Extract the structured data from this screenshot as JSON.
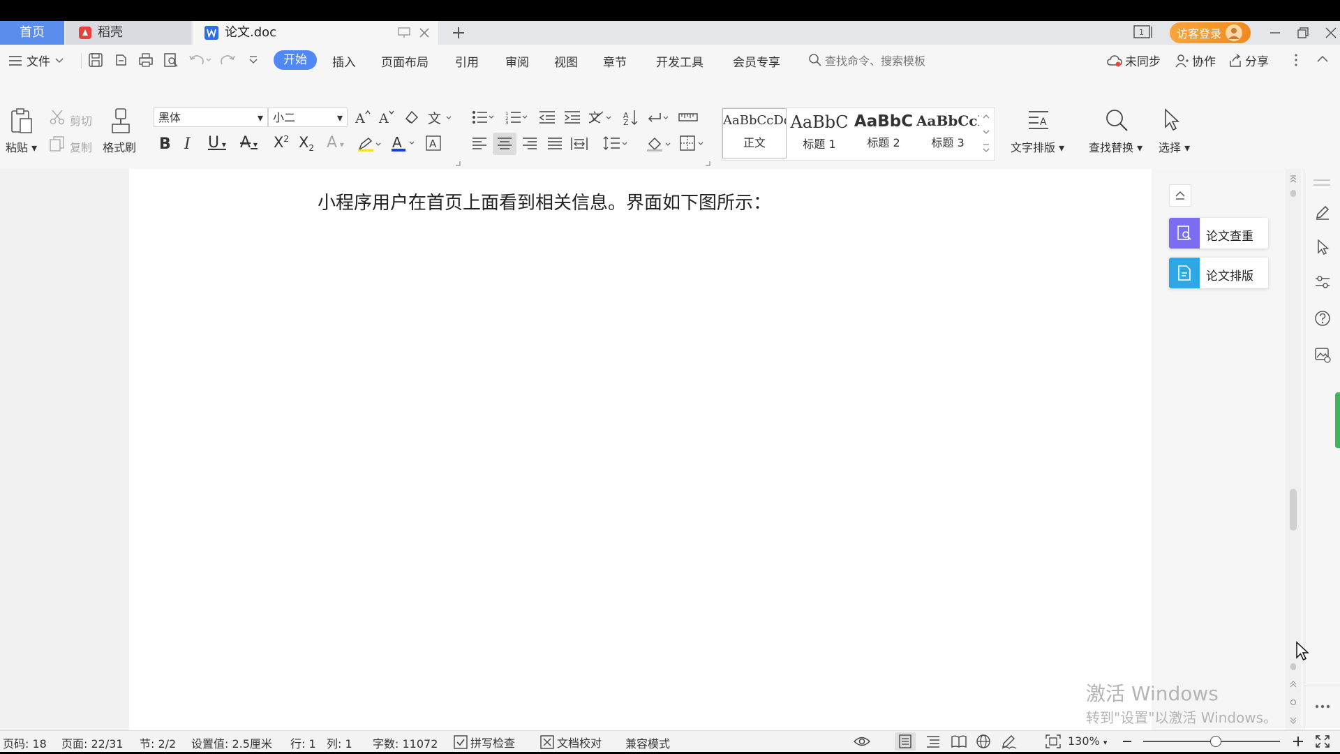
{
  "tabs": {
    "home": "首页",
    "daoke": "稻壳",
    "doc": "论文.doc"
  },
  "titlebar": {
    "login": "访客登录"
  },
  "menu": {
    "file": "文件",
    "items": [
      "开始",
      "插入",
      "页面布局",
      "引用",
      "审阅",
      "视图",
      "章节",
      "开发工具",
      "会员专享"
    ],
    "search_placeholder": "查找命令、搜索模板",
    "sync": "未同步",
    "collab": "协作",
    "share": "分享"
  },
  "ribbon": {
    "paste": "粘贴",
    "cut": "剪切",
    "copy": "复制",
    "format_painter": "格式刷",
    "font_name": "黑体",
    "font_size": "小二",
    "styles": [
      {
        "sample": "AaBbCcDd",
        "name": "正文"
      },
      {
        "sample": "AaBbC",
        "name": "标题 1"
      },
      {
        "sample": "AaBbC",
        "name": "标题 2"
      },
      {
        "sample": "AaBbCcI",
        "name": "标题 3"
      }
    ],
    "text_layout": "文字排版",
    "find_replace": "查找替换",
    "select": "选择"
  },
  "document": {
    "paragraph": "小程序用户在首页上面看到相关信息。界面如下图所示："
  },
  "panel": {
    "check": "论文查重",
    "layout": "论文排版"
  },
  "watermark": {
    "line1": "激活 Windows",
    "line2": "转到\"设置\"以激活 Windows。"
  },
  "status": {
    "page_code": "页码: 18",
    "page": "页面: 22/31",
    "section": "节: 2/2",
    "setting": "设置值: 2.5厘米",
    "row": "行: 1",
    "col": "列: 1",
    "words": "字数: 11072",
    "spell": "拼写检查",
    "proof": "文档校对",
    "compat": "兼容模式",
    "zoom": "130%"
  }
}
